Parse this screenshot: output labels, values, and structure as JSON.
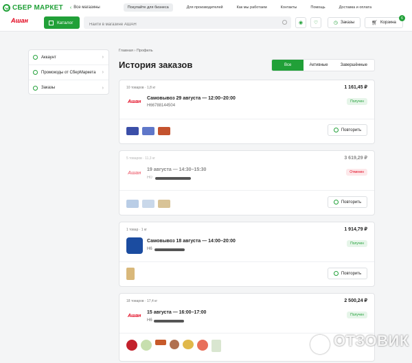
{
  "topbar": {
    "logo": "СБЕР МАРКЕТ",
    "stores_link": "Все магазины",
    "business_button": "Покупайте для бизнеса",
    "links": [
      "Для производителей",
      "Как мы работаем",
      "Контакты",
      "Помощь",
      "Доставка и оплата"
    ]
  },
  "searchrow": {
    "store_logo": "Ашан",
    "catalog_label": "Каталог",
    "search_placeholder": "Найти в магазине АШАН",
    "orders_label": "Заказы",
    "cart_label": "Корзина",
    "cart_count": "6"
  },
  "sidebar": {
    "items": [
      {
        "label": "Аккаунт"
      },
      {
        "label": "Промокоды от СберМаркета"
      },
      {
        "label": "Заказы"
      }
    ]
  },
  "main": {
    "breadcrumb": "Главная › Профиль",
    "title": "История заказов",
    "tabs": [
      "Все",
      "Активные",
      "Завершённые"
    ]
  },
  "orders": [
    {
      "meta": "10 товаров · 1,8 кг",
      "price": "1 161,45 ₽",
      "store": "Ашан",
      "title": "Самовывоз 29 августа — 12:00–20:00",
      "number": "Н66788144504",
      "status": "Получен",
      "repeat": "Повторить"
    },
    {
      "meta": "5 товаров · 11,3 кг",
      "price": "3 619,29 ₽",
      "store": "Ашан",
      "title": "19 августа — 14:30–15:30",
      "number": "Н0",
      "status": "Отменен",
      "repeat": "Повторить"
    },
    {
      "meta": "1 товар · 1 кг",
      "price": "1 914,79 ₽",
      "store": "",
      "title": "Самовывоз 18 августа — 14:00–20:00",
      "number": "Н6",
      "status": "Получен",
      "repeat": "Повторить"
    },
    {
      "meta": "18 товаров · 17,4 кг",
      "price": "2 500,24 ₽",
      "store": "Ашан",
      "title": "15 августа — 16:00–17:00",
      "number": "Н6",
      "status": "Получен",
      "repeat": "Повторить"
    }
  ],
  "watermark": "ОТЗОВИК",
  "colors": {
    "accent": "#21a038",
    "auchan": "#e2001a",
    "cancel": "#e2001a"
  }
}
